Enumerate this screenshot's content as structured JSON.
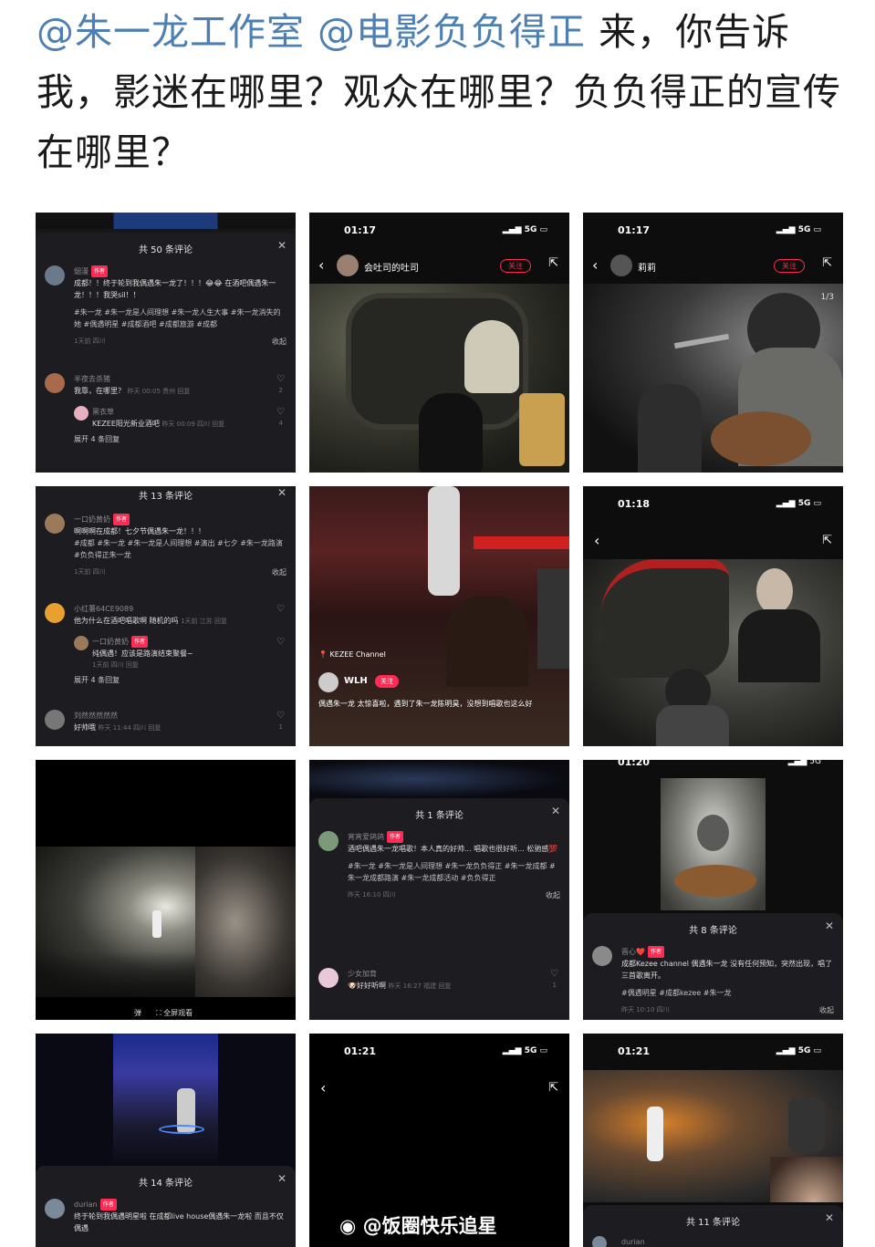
{
  "post": {
    "mention1": "@朱一龙工作室",
    "mention2": "@电影负负得正",
    "text": " 来，你告诉我，影迷在哪里？观众在哪里？负负得正的宣传在哪里？"
  },
  "cell1": {
    "title": "共 50 条评论",
    "c1_user": "烟漫",
    "author_tag": "作者",
    "c1_text": "成都！！终于轮到我偶遇朱一龙了！！！😂😂 在酒吧偶遇朱一龙！！！我哭sil！！",
    "c1_tags": "#朱一龙 #朱一龙是人间理想 #朱一龙人生大事 #朱一龙消失的她 #偶遇明星 #成都酒吧 #成都旅游 #成都",
    "c1_meta": "1天前 四川",
    "collapse": "收起",
    "c2_user": "半夜去杀猪",
    "c2_text": "我靠，在哪里？",
    "c2_meta": "昨天 00:05 贵州 回复",
    "c2_likes": "2",
    "c3_user": "黑衣草",
    "c3_text": "KEZEE阳光新业酒吧",
    "c3_meta": "昨天 00:09 四川 回复",
    "c3_likes": "4",
    "expand": "展开 4 条回复"
  },
  "cell2": {
    "time": "01:17",
    "signal": "5G",
    "user": "会吐司的吐司",
    "follow": "关注"
  },
  "cell3": {
    "time": "01:17",
    "signal": "5G",
    "user": "莉莉",
    "follow": "关注",
    "page": "1/3"
  },
  "cell4": {
    "title": "共 13 条评论",
    "c1_user": "一口奶黄奶",
    "author_tag": "作者",
    "c1_text": "啊啊啊在成都！七夕节偶遇朱一龙！！！",
    "c1_tags": "#成都 #朱一龙 #朱一龙是人间理想 #演出 #七夕 #朱一龙路演 #负负得正朱一龙",
    "c1_meta": "1天前 四川",
    "collapse": "收起",
    "c2_user": "小红薯64CE9089",
    "c2_text": "他为什么在酒吧唱歌啊 随机的吗",
    "c2_meta": "1天前 江苏 回复",
    "c3_user": "一口奶黄奶",
    "c3_text": "纯偶遇！应该是路演结束聚餐~",
    "c3_meta": "1天前 四川 回复",
    "expand": "展开 4 条回复",
    "c4_user": "刘然然然然然",
    "c4_text": "好帅哦",
    "c4_meta": "昨天 11:44 四川 回复",
    "c4_likes": "1"
  },
  "cell5": {
    "location": "KEZEE Channel",
    "user": "WLH",
    "follow": "关注",
    "caption": "偶遇朱一龙 太惊喜啦，遇到了朱一龙陈明昊，没想到唱歌也这么好"
  },
  "cell6": {
    "time": "01:18",
    "signal": "5G"
  },
  "cell7": {
    "btn1": "弹",
    "btn2": "全屏观看"
  },
  "cell8": {
    "title": "共 1 条评论",
    "c1_user": "宵宵爱鸽鸽",
    "author_tag": "作者",
    "c1_text": "酒吧偶遇朱一龙唱歌！本人真的好帅... 唱歌也很好听... 松驰感💯",
    "c1_tags": "#朱一龙 #朱一龙是人间理想 #朱一龙负负得正 #朱一龙成都 #朱一龙成都路演 #朱一龙成都活动 #负负得正",
    "c1_meta": "昨天 16:10 四川",
    "collapse": "收起",
    "c2_user": "少女加育",
    "c2_text": "🐶好好听啊",
    "c2_meta": "昨天 16:27 福建 回复",
    "c2_likes": "1"
  },
  "cell9": {
    "time": "01:20",
    "signal": "5G",
    "title": "共 8 条评论",
    "c1_user": "晋心❤️",
    "author_tag": "作者",
    "c1_text": "成都Kezee channel 偶遇朱一龙 没有任何预知，突然出现，唱了三首歌离开。",
    "c1_tags": "#偶遇明星 #成都kezee #朱一龙",
    "c1_meta": "昨天 10:10 四川",
    "collapse": "收起"
  },
  "cell10": {
    "title": "共 14 条评论",
    "c1_user": "durian",
    "author_tag": "作者",
    "c1_text": "终于轮到我偶遇明星啦 在成都live house偶遇朱一龙啦 而且不仅偶遇"
  },
  "cell11": {
    "time": "01:21",
    "signal": "5G"
  },
  "cell12": {
    "time": "01:21",
    "signal": "5G",
    "title": "共 11 条评论",
    "c1_user": "durian"
  },
  "watermark": "@饭圈快乐追星",
  "colors": {
    "accent": "#fe2c55",
    "mention": "#4d7fb3",
    "panel": "#1d1d21"
  }
}
